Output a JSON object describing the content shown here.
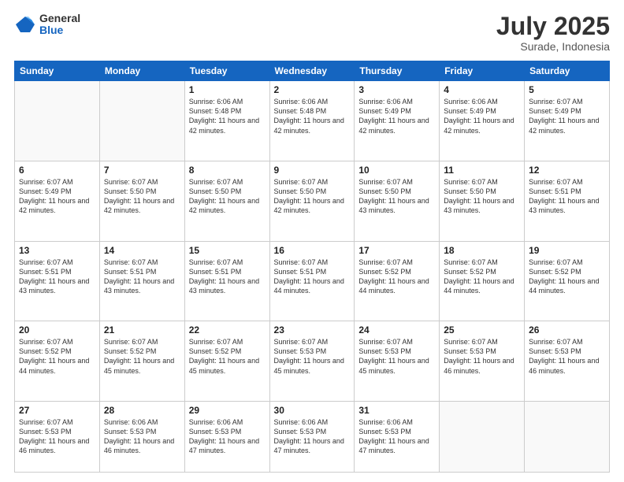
{
  "logo": {
    "general": "General",
    "blue": "Blue"
  },
  "header": {
    "month": "July 2025",
    "location": "Surade, Indonesia"
  },
  "weekdays": [
    "Sunday",
    "Monday",
    "Tuesday",
    "Wednesday",
    "Thursday",
    "Friday",
    "Saturday"
  ],
  "weeks": [
    [
      {
        "day": "",
        "info": ""
      },
      {
        "day": "",
        "info": ""
      },
      {
        "day": "1",
        "info": "Sunrise: 6:06 AM\nSunset: 5:48 PM\nDaylight: 11 hours\nand 42 minutes."
      },
      {
        "day": "2",
        "info": "Sunrise: 6:06 AM\nSunset: 5:48 PM\nDaylight: 11 hours\nand 42 minutes."
      },
      {
        "day": "3",
        "info": "Sunrise: 6:06 AM\nSunset: 5:49 PM\nDaylight: 11 hours\nand 42 minutes."
      },
      {
        "day": "4",
        "info": "Sunrise: 6:06 AM\nSunset: 5:49 PM\nDaylight: 11 hours\nand 42 minutes."
      },
      {
        "day": "5",
        "info": "Sunrise: 6:07 AM\nSunset: 5:49 PM\nDaylight: 11 hours\nand 42 minutes."
      }
    ],
    [
      {
        "day": "6",
        "info": "Sunrise: 6:07 AM\nSunset: 5:49 PM\nDaylight: 11 hours\nand 42 minutes."
      },
      {
        "day": "7",
        "info": "Sunrise: 6:07 AM\nSunset: 5:50 PM\nDaylight: 11 hours\nand 42 minutes."
      },
      {
        "day": "8",
        "info": "Sunrise: 6:07 AM\nSunset: 5:50 PM\nDaylight: 11 hours\nand 42 minutes."
      },
      {
        "day": "9",
        "info": "Sunrise: 6:07 AM\nSunset: 5:50 PM\nDaylight: 11 hours\nand 42 minutes."
      },
      {
        "day": "10",
        "info": "Sunrise: 6:07 AM\nSunset: 5:50 PM\nDaylight: 11 hours\nand 43 minutes."
      },
      {
        "day": "11",
        "info": "Sunrise: 6:07 AM\nSunset: 5:50 PM\nDaylight: 11 hours\nand 43 minutes."
      },
      {
        "day": "12",
        "info": "Sunrise: 6:07 AM\nSunset: 5:51 PM\nDaylight: 11 hours\nand 43 minutes."
      }
    ],
    [
      {
        "day": "13",
        "info": "Sunrise: 6:07 AM\nSunset: 5:51 PM\nDaylight: 11 hours\nand 43 minutes."
      },
      {
        "day": "14",
        "info": "Sunrise: 6:07 AM\nSunset: 5:51 PM\nDaylight: 11 hours\nand 43 minutes."
      },
      {
        "day": "15",
        "info": "Sunrise: 6:07 AM\nSunset: 5:51 PM\nDaylight: 11 hours\nand 43 minutes."
      },
      {
        "day": "16",
        "info": "Sunrise: 6:07 AM\nSunset: 5:51 PM\nDaylight: 11 hours\nand 44 minutes."
      },
      {
        "day": "17",
        "info": "Sunrise: 6:07 AM\nSunset: 5:52 PM\nDaylight: 11 hours\nand 44 minutes."
      },
      {
        "day": "18",
        "info": "Sunrise: 6:07 AM\nSunset: 5:52 PM\nDaylight: 11 hours\nand 44 minutes."
      },
      {
        "day": "19",
        "info": "Sunrise: 6:07 AM\nSunset: 5:52 PM\nDaylight: 11 hours\nand 44 minutes."
      }
    ],
    [
      {
        "day": "20",
        "info": "Sunrise: 6:07 AM\nSunset: 5:52 PM\nDaylight: 11 hours\nand 44 minutes."
      },
      {
        "day": "21",
        "info": "Sunrise: 6:07 AM\nSunset: 5:52 PM\nDaylight: 11 hours\nand 45 minutes."
      },
      {
        "day": "22",
        "info": "Sunrise: 6:07 AM\nSunset: 5:52 PM\nDaylight: 11 hours\nand 45 minutes."
      },
      {
        "day": "23",
        "info": "Sunrise: 6:07 AM\nSunset: 5:53 PM\nDaylight: 11 hours\nand 45 minutes."
      },
      {
        "day": "24",
        "info": "Sunrise: 6:07 AM\nSunset: 5:53 PM\nDaylight: 11 hours\nand 45 minutes."
      },
      {
        "day": "25",
        "info": "Sunrise: 6:07 AM\nSunset: 5:53 PM\nDaylight: 11 hours\nand 46 minutes."
      },
      {
        "day": "26",
        "info": "Sunrise: 6:07 AM\nSunset: 5:53 PM\nDaylight: 11 hours\nand 46 minutes."
      }
    ],
    [
      {
        "day": "27",
        "info": "Sunrise: 6:07 AM\nSunset: 5:53 PM\nDaylight: 11 hours\nand 46 minutes."
      },
      {
        "day": "28",
        "info": "Sunrise: 6:06 AM\nSunset: 5:53 PM\nDaylight: 11 hours\nand 46 minutes."
      },
      {
        "day": "29",
        "info": "Sunrise: 6:06 AM\nSunset: 5:53 PM\nDaylight: 11 hours\nand 47 minutes."
      },
      {
        "day": "30",
        "info": "Sunrise: 6:06 AM\nSunset: 5:53 PM\nDaylight: 11 hours\nand 47 minutes."
      },
      {
        "day": "31",
        "info": "Sunrise: 6:06 AM\nSunset: 5:53 PM\nDaylight: 11 hours\nand 47 minutes."
      },
      {
        "day": "",
        "info": ""
      },
      {
        "day": "",
        "info": ""
      }
    ]
  ]
}
